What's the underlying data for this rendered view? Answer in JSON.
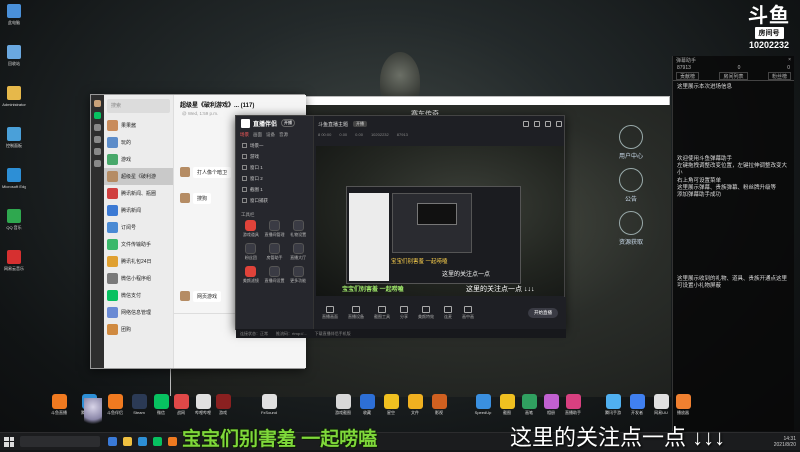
{
  "overlay": {
    "logo_mark": "斗鱼",
    "room_label": "房间号",
    "room_id": "10202232"
  },
  "desktop_icons": [
    {
      "label": "此电脑",
      "color": "#4a90d9"
    },
    {
      "label": "回收站",
      "color": "#6aa8e0"
    },
    {
      "label": "Administrator",
      "color": "#e6b84a"
    },
    {
      "label": "控制面板",
      "color": "#4aa0d9"
    },
    {
      "label": "Microsoft Edge",
      "color": "#2d8fd6"
    },
    {
      "label": "QQ 音乐",
      "color": "#2fa84f"
    },
    {
      "label": "网易云音乐",
      "color": "#d63030"
    }
  ],
  "danmu": {
    "header": "弹幕助手",
    "stats": [
      "87913",
      "0",
      "0"
    ],
    "tabs": [
      "贡献榜",
      "房间列表",
      "粉丝榜"
    ],
    "top_msg": "这里展示本次进场信息",
    "welcome_lines": [
      "欢迎使用斗鱼弹幕助手",
      "左键拖拽调整改变位置，左键拉伸调整改变大小",
      "右上角可设置菜单",
      "这里展示弹幕、贵族弹幕、粉丝牌升级等",
      "添加弹幕助手成功"
    ],
    "gift_msg": "这里展示收到的礼物、道具、贵族开通点这里可设置小礼物屏蔽"
  },
  "wechat": {
    "search": "搜索",
    "chat_title": "超级星《破利游戏》... (117)",
    "chat_sub": "@ Wed, 1:59 p.m.",
    "contacts": [
      {
        "name": "果果酱",
        "color": "#c98c5c"
      },
      {
        "name": "玩的",
        "color": "#5c8cc9"
      },
      {
        "name": "游戏",
        "color": "#48a86a"
      },
      {
        "name": "超级星《破利游",
        "color": "#b58c64"
      },
      {
        "name": "腾讯新闻、瓶圈",
        "color": "#d04040"
      },
      {
        "name": "腾讯新闻",
        "color": "#3c7ad4"
      },
      {
        "name": "订阅号",
        "color": "#4a8ad4"
      },
      {
        "name": "文件传输助手",
        "color": "#3ab86a"
      },
      {
        "name": "腾讯礼包24日",
        "color": "#e0a030"
      },
      {
        "name": "微信小程序组",
        "color": "#7a7a7a"
      },
      {
        "name": "微信支付",
        "color": "#07c160"
      },
      {
        "name": "网络信息管理",
        "color": "#6a8ad4"
      },
      {
        "name": "团购",
        "color": "#d08a40"
      }
    ],
    "bubbles": [
      "打人像个暗卫",
      "搜狗",
      "网页游戏"
    ]
  },
  "stream_window": {
    "title": "赛车传奇",
    "game_ui": [
      "用户中心",
      "公告",
      "资源获取"
    ]
  },
  "zbbl": {
    "app_name": "直播伴侣",
    "app_pill": "开播",
    "tabs": [
      "场景",
      "画面",
      "设备",
      "音源"
    ],
    "scenes": [
      "场景一",
      "游戏",
      "窗口 1",
      "窗口 2",
      "截图 1",
      "窗口捕获"
    ],
    "tools_title": "工具栏",
    "tools": [
      "游戏道具",
      "直播间管理",
      "礼物设置",
      "粉丝团",
      "房管助手",
      "直播大厅",
      "美颜滤镜",
      "直播间设置",
      "更多功能"
    ],
    "header_title": "斗鱼直播主题",
    "header_pill": "开播",
    "stats": [
      "8 00:00",
      "0.00",
      "0.00",
      "10202232",
      "87913"
    ],
    "preview_caption_left": "宝宝们别害羞 一起唠嗑",
    "preview_caption_right": "这里的关注点一点 ↓↓↓",
    "nested_caption": "宝宝们别害羞 一起唠嗑",
    "nested_caption2": "这里的关注点一点",
    "bottom_items": [
      "直播画面",
      "直播设备",
      "截图工具",
      "分享",
      "美颜特效",
      "连麦",
      "画中画"
    ],
    "live_button": "开始直播",
    "footer": [
      "连接状态：正常",
      "推流码：rtmp://...",
      "下载直播伴侣手机版"
    ]
  },
  "taskbar_apps": [
    {
      "label": "斗鱼直播",
      "color": "#f07a20"
    },
    {
      "label": "腾讯视频",
      "color": "#2d8fd6"
    },
    {
      "label": "斗鱼伴侣",
      "color": "#f07a20"
    },
    {
      "label": "Steam",
      "color": "#2b3a55"
    },
    {
      "label": "微信",
      "color": "#07c160"
    },
    {
      "label": "战网",
      "color": "#e04848"
    },
    {
      "label": "哔哩哔哩",
      "color": "#e0e0e0"
    },
    {
      "label": "游戏",
      "color": "#8a2020"
    },
    {
      "label": "FxSound",
      "color": "#e0e0e0"
    },
    {
      "label": "游戏截图",
      "color": "#d8d8d8"
    },
    {
      "label": "收藏",
      "color": "#2d6fd6"
    },
    {
      "label": "星空",
      "color": "#f0c020"
    },
    {
      "label": "文件",
      "color": "#f0b020"
    },
    {
      "label": "影视",
      "color": "#d06020"
    },
    {
      "label": "SpeedUp",
      "color": "#3a90e0"
    },
    {
      "label": "截图",
      "color": "#f0c020"
    },
    {
      "label": "画笔",
      "color": "#30a060"
    },
    {
      "label": "相册",
      "color": "#c060d0"
    },
    {
      "label": "直播助手",
      "color": "#d84080"
    },
    {
      "label": "腾讯手游",
      "color": "#50b0f0"
    },
    {
      "label": "开发者",
      "color": "#4080f0"
    },
    {
      "label": "网易UU",
      "color": "#e0e0e0"
    },
    {
      "label": "播放器",
      "color": "#f08030"
    }
  ],
  "subtitle_left": "宝宝们别害羞 一起唠嗑",
  "subtitle_right": "这里的关注点一点 ↓↓↓",
  "clock": {
    "time": "14:31",
    "date": "2021/8/20"
  }
}
